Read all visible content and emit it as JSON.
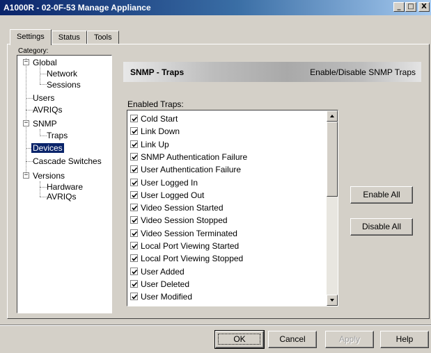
{
  "window": {
    "title": "A1000R - 02-0F-53 Manage Appliance",
    "minimize": "_",
    "maximize": "□",
    "close": "X"
  },
  "tabs": [
    {
      "label": "Settings",
      "active": true
    },
    {
      "label": "Status",
      "active": false
    },
    {
      "label": "Tools",
      "active": false
    }
  ],
  "category": {
    "label": "Category:",
    "tree": {
      "global": "Global",
      "network": "Network",
      "sessions": "Sessions",
      "users": "Users",
      "avriqs": "AVRIQs",
      "snmp": "SNMP",
      "traps": "Traps",
      "devices": "Devices",
      "cascade_switches": "Cascade Switches",
      "versions": "Versions",
      "hardware": "Hardware",
      "avriqs_versions": "AVRIQs"
    },
    "selected": "Devices"
  },
  "header": {
    "title": "SNMP - Traps",
    "subtitle": "Enable/Disable SNMP Traps"
  },
  "traps": {
    "label": "Enabled Traps:",
    "items": [
      {
        "label": "Cold Start",
        "checked": true
      },
      {
        "label": "Link Down",
        "checked": true
      },
      {
        "label": "Link Up",
        "checked": true
      },
      {
        "label": "SNMP Authentication Failure",
        "checked": true
      },
      {
        "label": "User Authentication Failure",
        "checked": true
      },
      {
        "label": "User Logged In",
        "checked": true
      },
      {
        "label": "User Logged Out",
        "checked": true
      },
      {
        "label": "Video Session Started",
        "checked": true
      },
      {
        "label": "Video Session Stopped",
        "checked": true
      },
      {
        "label": "Video Session Terminated",
        "checked": true
      },
      {
        "label": "Local Port Viewing Started",
        "checked": true
      },
      {
        "label": "Local Port Viewing Stopped",
        "checked": true
      },
      {
        "label": "User Added",
        "checked": true
      },
      {
        "label": "User Deleted",
        "checked": true
      },
      {
        "label": "User Modified",
        "checked": true
      }
    ],
    "enable_all": "Enable All",
    "disable_all": "Disable All"
  },
  "footer": {
    "ok": "OK",
    "cancel": "Cancel",
    "apply": "Apply",
    "help": "Help"
  }
}
